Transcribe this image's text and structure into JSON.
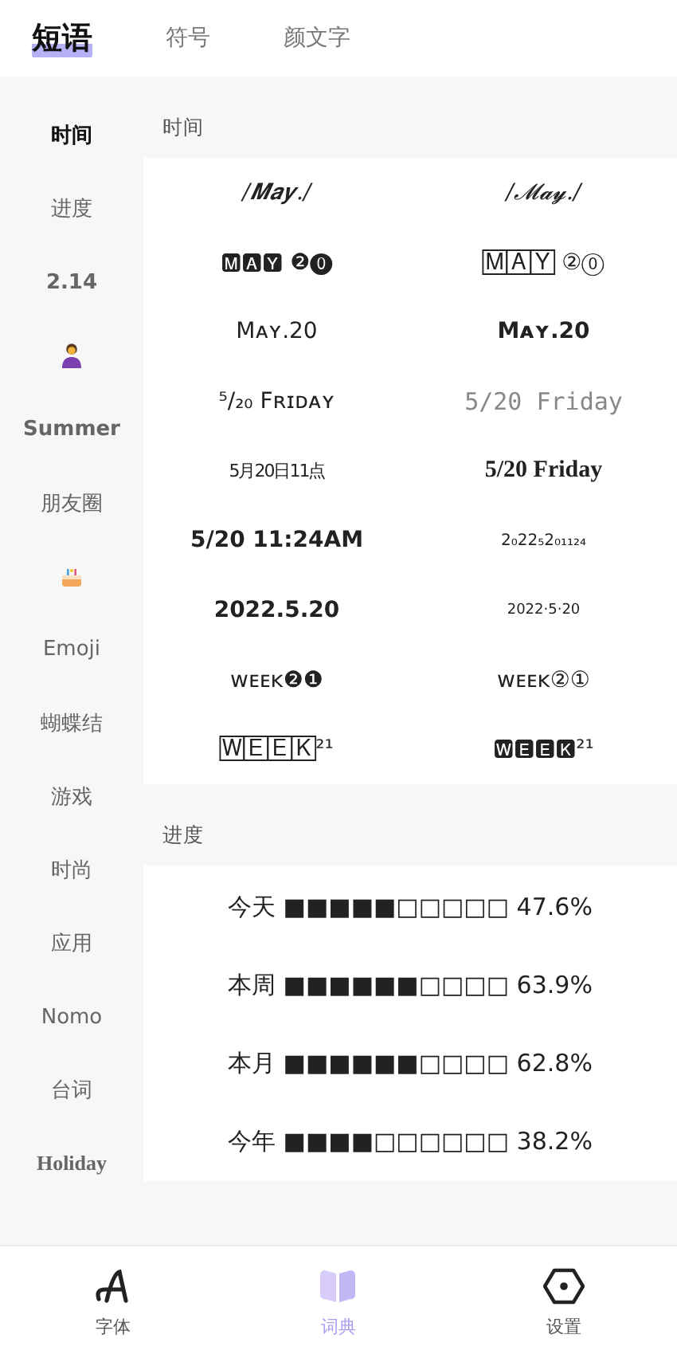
{
  "tabs": [
    {
      "label": "短语",
      "selected": true
    },
    {
      "label": "符号",
      "selected": false
    },
    {
      "label": "颜文字",
      "selected": false
    }
  ],
  "sidebar": {
    "items": [
      {
        "kind": "text",
        "label": "时间",
        "selected": true
      },
      {
        "kind": "text",
        "label": "进度",
        "selected": false
      },
      {
        "kind": "bold",
        "label": "2.14",
        "selected": false
      },
      {
        "kind": "woman",
        "selected": false
      },
      {
        "kind": "bold",
        "label": "Summer",
        "selected": false
      },
      {
        "kind": "text",
        "label": "朋友圈",
        "selected": false
      },
      {
        "kind": "cake",
        "selected": false
      },
      {
        "kind": "text",
        "label": "Emoji",
        "selected": false
      },
      {
        "kind": "text",
        "label": "蝴蝶结",
        "selected": false
      },
      {
        "kind": "text",
        "label": "游戏",
        "selected": false
      },
      {
        "kind": "text",
        "label": "时尚",
        "selected": false
      },
      {
        "kind": "text",
        "label": "应用",
        "selected": false
      },
      {
        "kind": "text",
        "label": "Nomo",
        "selected": false
      },
      {
        "kind": "text",
        "label": "台词",
        "selected": false
      },
      {
        "kind": "serif",
        "label": "Holiday",
        "selected": false
      }
    ]
  },
  "sections": [
    {
      "title": "时间",
      "phrases": [
        "/𝑴𝒂𝒚./",
        "/𝓜𝓪𝔂./",
        "🅼🅰🆈 ❷⓿",
        "🄼🄰🅈 ②⓪",
        "Mᴀʏ.20",
        "Mᴀʏ.20",
        "⁵/₂₀ Fʀɪᴅᴀʏ",
        "5/20 Friday",
        "5月20日11点",
        "5/20 Friday",
        "5/20 11:24AM",
        "2₀22₅2₀₁₁₂₄",
        "2022.5.20",
        "2022·5·20",
        "ᴡᴇᴇᴋ❷❶",
        "ᴡᴇᴇᴋ②①",
        "🅆🄴🄴🄺²¹",
        "🆆🅴🅴🅺²¹"
      ]
    },
    {
      "title": "进度",
      "phrases": [
        "今天 ■■■■■□□□□□ 47.6%",
        "本周 ■■■■■■□□□□ 63.9%",
        "本月 ■■■■■■□□□□ 62.8%",
        "今年 ■■■■□□□□□□ 38.2%"
      ]
    }
  ],
  "bottom_nav": [
    {
      "kind": "font",
      "label": "字体",
      "selected": false
    },
    {
      "kind": "book",
      "label": "词典",
      "selected": true
    },
    {
      "kind": "settings",
      "label": "设置",
      "selected": false
    }
  ]
}
